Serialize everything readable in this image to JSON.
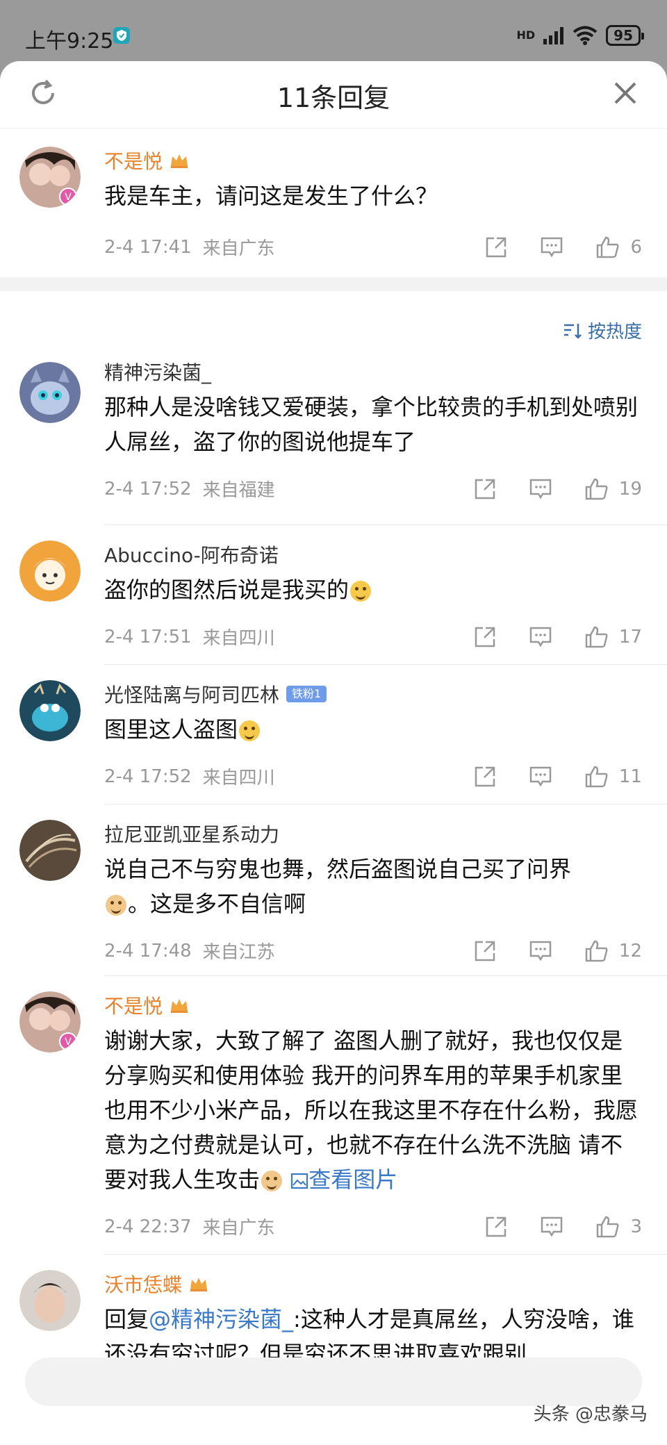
{
  "status": {
    "time": "上午9:25",
    "network": "HD",
    "battery": "95"
  },
  "header": {
    "title": "11条回复"
  },
  "root_comment": {
    "user": "不是悦",
    "text": "我是车主，请问这是发生了什么？",
    "time": "2-4 17:41",
    "location": "来自广东",
    "likes": "6"
  },
  "sort": {
    "label": "按热度"
  },
  "replies": [
    {
      "user": "精神污染菌_",
      "text": "那种人是没啥钱又爱硬装，拿个比较贵的手机到处喷别人屌丝，盗了你的图说他提车了",
      "time": "2-4 17:52",
      "location": "来自福建",
      "likes": "19"
    },
    {
      "user": "Abuccino-阿布奇诺",
      "text": "盗你的图然后说是我买的",
      "time": "2-4 17:51",
      "location": "来自四川",
      "likes": "17"
    },
    {
      "user": "光怪陆离与阿司匹林",
      "badge": "铁粉1",
      "text": "图里这人盗图",
      "time": "2-4 17:52",
      "location": "来自四川",
      "likes": "11"
    },
    {
      "user": "拉尼亚凯亚星系动力",
      "text": "说自己不与穷鬼也舞，然后盗图说自己买了问界",
      "text2": "。这是多不自信啊",
      "time": "2-4 17:48",
      "location": "来自江苏",
      "likes": "12"
    },
    {
      "user": "不是悦",
      "text": "谢谢大家，大致了解了 盗图人删了就好，我也仅仅是分享购买和使用体验 我开的问界车用的苹果手机家里也用不少小米产品，所以在我这里不存在什么粉，我愿意为之付费就是认可，也就不存在什么洗不洗脑 请不要对我人生攻击",
      "link": "查看图片",
      "time": "2-4 22:37",
      "location": "来自广东",
      "likes": "3"
    },
    {
      "user": "沃市恁蝶",
      "prefix": "回复",
      "mention": "@精神污染菌_",
      "text": ":这种人才是真屌丝，人穷没啥，谁还没有穷过呢？但是穷还不思进取喜欢跟别"
    }
  ],
  "watermark": "头条 @忠豢马"
}
